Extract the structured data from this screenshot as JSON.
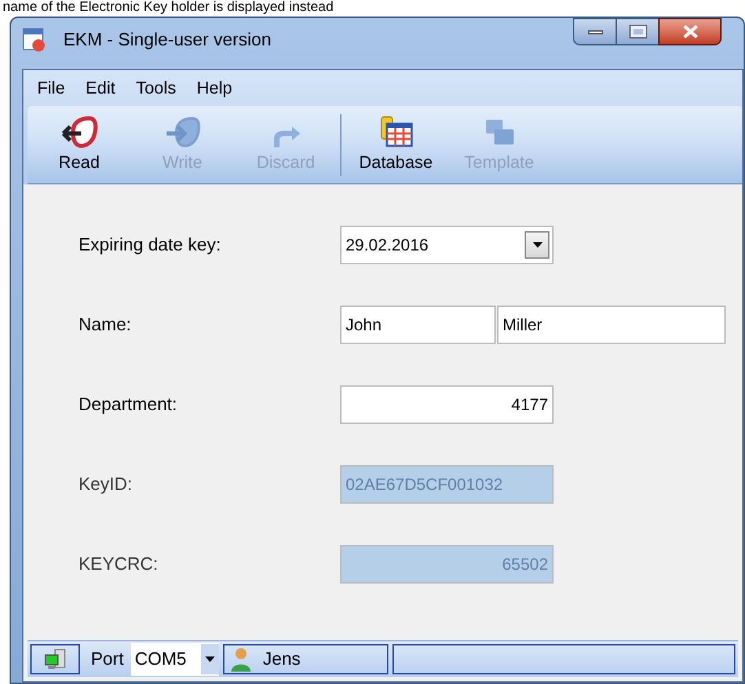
{
  "caption": "name of the Electronic Key holder is displayed instead",
  "window": {
    "title": "EKM - Single-user version"
  },
  "menu": [
    {
      "label": "File"
    },
    {
      "label": "Edit"
    },
    {
      "label": "Tools"
    },
    {
      "label": "Help"
    }
  ],
  "toolbar": [
    {
      "label": "Read",
      "kind": "read",
      "disabled": false
    },
    {
      "label": "Write",
      "kind": "write",
      "disabled": true
    },
    {
      "label": "Discard",
      "kind": "discard",
      "disabled": true
    },
    {
      "label": "Database",
      "kind": "database",
      "disabled": false
    },
    {
      "label": "Template",
      "kind": "template",
      "disabled": true
    }
  ],
  "form": [
    {
      "label": "Expiring date key:",
      "kind": "combo",
      "values": [
        "29.02.2016"
      ],
      "disabled": false
    },
    {
      "label": "Name:",
      "kind": "pair",
      "values": [
        "John",
        "Miller"
      ],
      "disabled": false
    },
    {
      "label": "Department:",
      "kind": "number",
      "values": [
        "4177"
      ],
      "disabled": false
    },
    {
      "label": "KeyID:",
      "kind": "text",
      "values": [
        "02AE67D5CF001032"
      ],
      "disabled": true
    },
    {
      "label": "KEYCRC:",
      "kind": "number",
      "values": [
        "65502"
      ],
      "disabled": true
    }
  ],
  "status_bar": {
    "port_label": "Port",
    "port": "COM5",
    "user": "Jens"
  }
}
